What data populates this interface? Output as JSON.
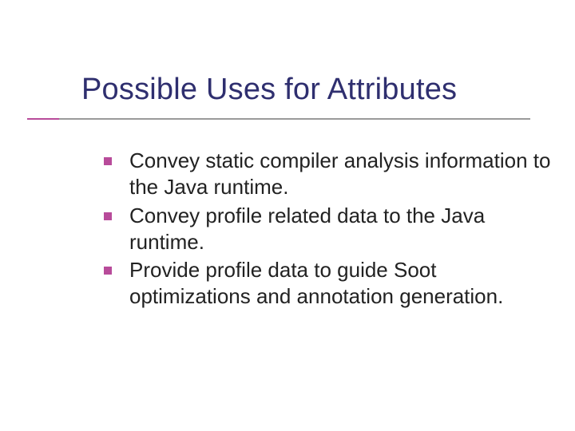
{
  "slide": {
    "title": "Possible Uses for Attributes",
    "bullets": [
      {
        "text": "Convey static compiler analysis information to the Java runtime."
      },
      {
        "text": "Convey profile related data to the Java runtime."
      },
      {
        "text": "Provide profile data to guide Soot optimizations and annotation generation."
      }
    ]
  }
}
